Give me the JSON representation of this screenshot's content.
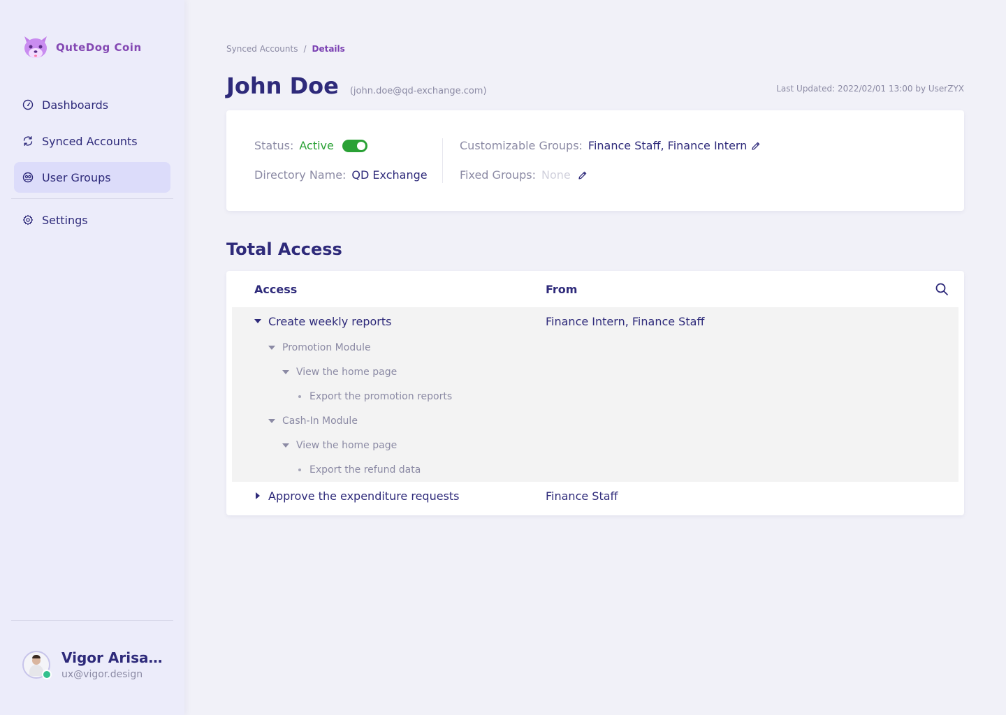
{
  "sidebar": {
    "brand": "QuteDog Coin",
    "items": [
      {
        "label": "Dashboards",
        "icon": "gauge-icon"
      },
      {
        "label": "Synced Accounts",
        "icon": "sync-icon"
      },
      {
        "label": "User Groups",
        "icon": "users-icon",
        "active": true
      },
      {
        "label": "Settings",
        "icon": "gear-icon"
      }
    ],
    "profile": {
      "name": "Vigor Arisan...",
      "email": "ux@vigor.design",
      "status": "online"
    }
  },
  "breadcrumb": {
    "parent": "Synced Accounts",
    "separator": "/",
    "current": "Details"
  },
  "header": {
    "name": "John Doe",
    "email": "(john.doe@qd-exchange.com)",
    "last_updated": "Last Updated: 2022/02/01 13:00 by UserZYX"
  },
  "details": {
    "status_label": "Status:",
    "status_value": "Active",
    "status_on": true,
    "directory_label": "Directory Name:",
    "directory_value": "QD Exchange",
    "custom_groups_label": "Customizable Groups:",
    "custom_groups_value": "Finance Staff, Finance Intern",
    "fixed_groups_label": "Fixed Groups:",
    "fixed_groups_value": "None"
  },
  "access": {
    "section_title": "Total Access",
    "columns": {
      "access": "Access",
      "from": "From"
    },
    "rows": [
      {
        "label": "Create weekly reports",
        "from": "Finance Intern, Finance Staff",
        "expanded": true,
        "children": [
          {
            "label": "Promotion Module",
            "level": 1
          },
          {
            "label": "View the home page",
            "level": 2
          },
          {
            "label": "Export the promotion reports",
            "level": 3
          },
          {
            "label": "Cash-In Module",
            "level": 1
          },
          {
            "label": "View the home page",
            "level": 2
          },
          {
            "label": "Export the refund data",
            "level": 3
          }
        ]
      },
      {
        "label": "Approve the expenditure requests",
        "from": "Finance Staff",
        "expanded": false
      }
    ]
  },
  "colors": {
    "primary": "#2e2a7a",
    "brand": "#8448b3",
    "active_green": "#2aa135",
    "sidebar_bg": "#ececfa",
    "active_nav_bg": "#dcdcfa",
    "online": "#33c08d"
  }
}
